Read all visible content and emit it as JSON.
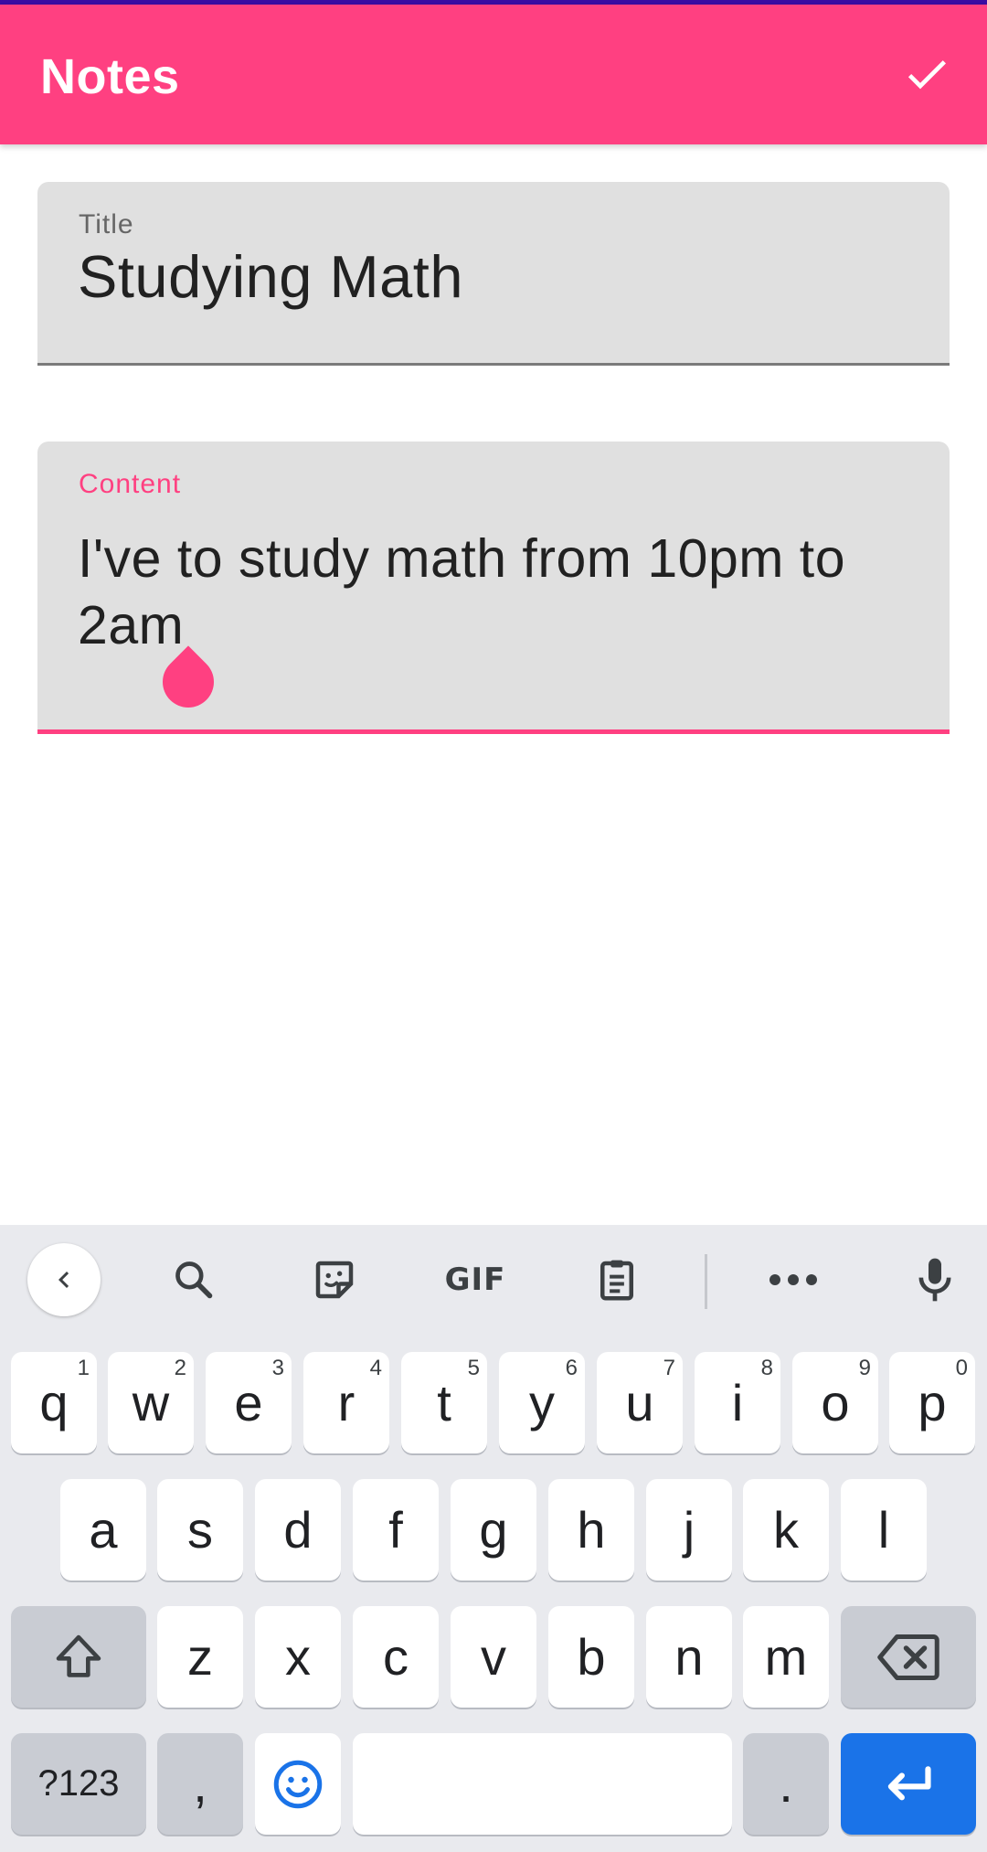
{
  "app_bar": {
    "title": "Notes",
    "save_icon": "check-icon",
    "background_color": "#ff4081"
  },
  "title_field": {
    "label": "Title",
    "value": "Studying Math"
  },
  "content_field": {
    "label": "Content",
    "value": "I've to study math from 10pm to 2am",
    "accent_color": "#ff4081"
  },
  "keyboard": {
    "toolbar": [
      "chevron-left-icon",
      "search-icon",
      "sticker-icon",
      "gif-icon",
      "clipboard-icon",
      "more-icon",
      "microphone-icon"
    ],
    "gif_label": "GIF",
    "row1": [
      {
        "key": "q",
        "hint": "1"
      },
      {
        "key": "w",
        "hint": "2"
      },
      {
        "key": "e",
        "hint": "3"
      },
      {
        "key": "r",
        "hint": "4"
      },
      {
        "key": "t",
        "hint": "5"
      },
      {
        "key": "y",
        "hint": "6"
      },
      {
        "key": "u",
        "hint": "7"
      },
      {
        "key": "i",
        "hint": "8"
      },
      {
        "key": "o",
        "hint": "9"
      },
      {
        "key": "p",
        "hint": "0"
      }
    ],
    "row2": [
      "a",
      "s",
      "d",
      "f",
      "g",
      "h",
      "j",
      "k",
      "l"
    ],
    "row3": [
      "z",
      "x",
      "c",
      "v",
      "b",
      "n",
      "m"
    ],
    "symbols_label": "?123",
    "comma_label": ",",
    "period_label": ".",
    "enter_color": "#1a73e8"
  }
}
